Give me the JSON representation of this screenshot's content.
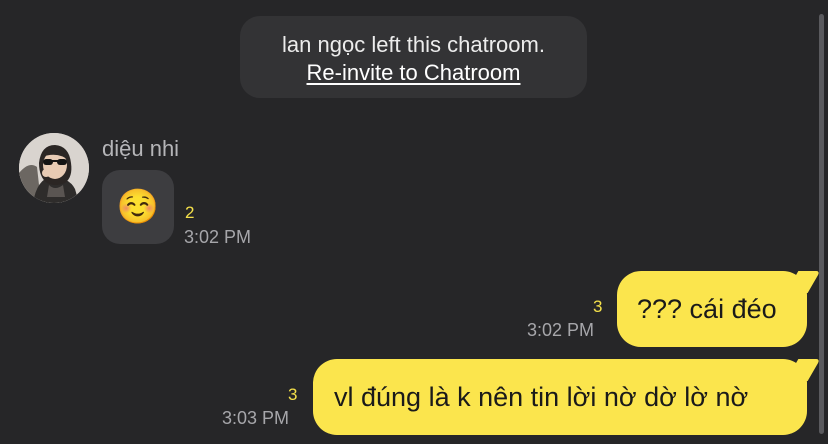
{
  "notice": {
    "left_text": "lan ngọc left this chatroom.",
    "reinvite_link": "Re-invite to Chatroom"
  },
  "incoming": {
    "sender_name": "diệu nhi",
    "emoji": "☺️",
    "unread_count": "2",
    "time": "3:02 PM"
  },
  "outgoing": [
    {
      "text": "??? cái đéo",
      "unread_count": "3",
      "time": "3:02 PM"
    },
    {
      "text": "vl đúng là k nên tin lời nờ dờ lờ nờ",
      "unread_count": "3",
      "time": "3:03 PM"
    }
  ],
  "colors": {
    "background": "#262628",
    "outgoing_bubble": "#fbe54d",
    "incoming_bubble": "#3d3d40",
    "unread_count": "#f4e04a"
  }
}
